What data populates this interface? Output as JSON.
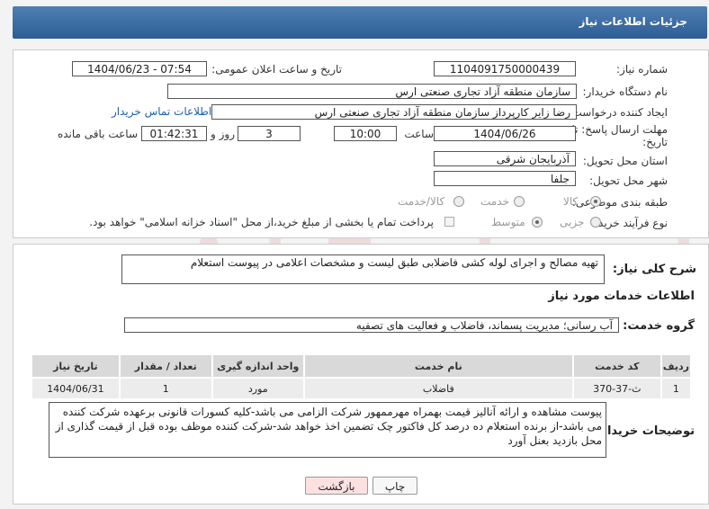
{
  "header": {
    "title": "جزئیات اطلاعات نیاز"
  },
  "fields": {
    "need_number_label": "شماره نیاز:",
    "need_number": "1104091750000439",
    "announce_label": "تاریخ و ساعت اعلان عمومی:",
    "announce_value": "1404/06/23 - 07:54",
    "buyer_label": "نام دستگاه خریدار:",
    "buyer_value": "سازمان منطقه آزاد تجاری صنعتی ارس",
    "creator_label": "ایجاد کننده درخواست:",
    "creator_value": "رضا زایر کارپرداز سازمان منطقه آزاد تجاری صنعتی ارس",
    "contact_link": "اطلاعات تماس خریدار",
    "deadline_label_1": "مهلت ارسال پاسخ: تا",
    "deadline_label_2": "تاریخ:",
    "deadline_date": "1404/06/26",
    "time_label": "ساعت",
    "deadline_time": "10:00",
    "days_value": "3",
    "days_label": "روز و",
    "remaining_time": "01:42:31",
    "remaining_label": "ساعت باقی مانده",
    "province_label": "استان محل تحویل:",
    "province_value": "آذربایجان شرقی",
    "city_label": "شهر محل تحویل:",
    "city_value": "جلفا",
    "category_label": "طبقه بندی موضوعی:",
    "category_options": [
      "کالا",
      "خدمت",
      "کالا/خدمت"
    ],
    "process_label": "نوع فرآیند خرید :",
    "process_options": [
      "جزیی",
      "متوسط"
    ],
    "payment_note": "پرداخت تمام یا بخشی از مبلغ خرید،از محل \"اسناد خزانه اسلامی\" خواهد بود."
  },
  "summary": {
    "label": "شرح کلی نیاز:",
    "value": "تهیه مصالح و اجرای لوله کشی فاضلابی طبق لیست و مشخصات اعلامی در پیوست استعلام"
  },
  "services": {
    "title": "اطلاعات خدمات مورد نیاز",
    "group_label": "گروه خدمت:",
    "group_value": "آب رسانی؛ مدیریت پسماند، فاضلاب و فعالیت های تصفیه",
    "columns": [
      "ردیف",
      "کد خدمت",
      "نام خدمت",
      "واحد اندازه گیری",
      "تعداد / مقدار",
      "تاریخ نیاز"
    ],
    "rows": [
      [
        "1",
        "ث-37-370",
        "فاضلاب",
        "مورد",
        "1",
        "1404/06/31"
      ]
    ]
  },
  "notes": {
    "label": "توضیحات خریدار:",
    "value": "پیوست مشاهده و ارائه آنالیز قیمت بهمراه مهرممهور شرکت الزامی می باشد-کلیه کسورات قانونی برعهده شرکت کننده می باشد-از برنده استعلام ده درصد کل فاکتور چک تضمین اخذ خواهد شد-شرکت کننده موظف بوده قبل از قیمت گذاری از محل بازدید بعنل آورد"
  },
  "buttons": {
    "print": "چاپ",
    "back": "بازگشت"
  },
  "watermark": "AriaTender.net"
}
